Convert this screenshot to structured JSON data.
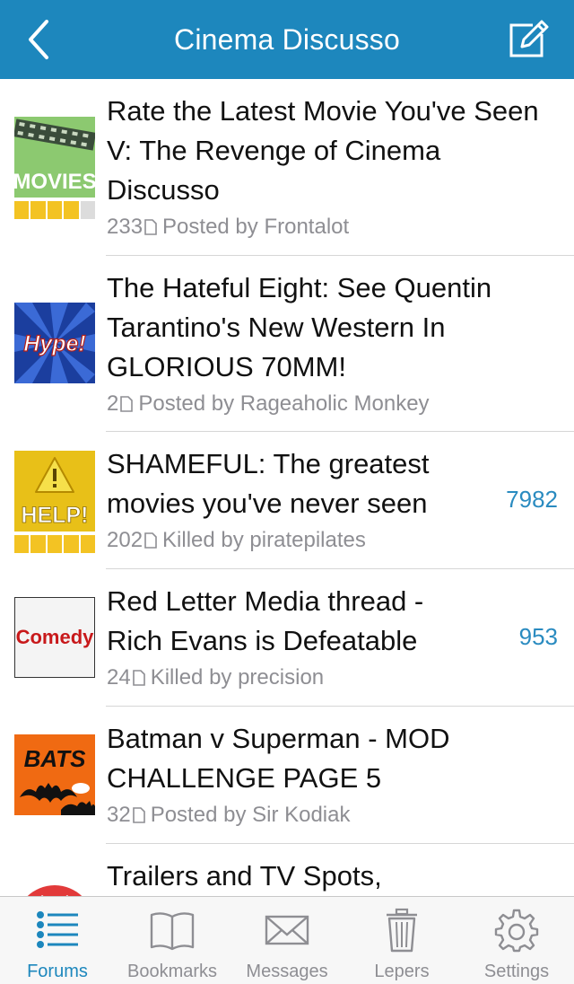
{
  "header": {
    "title": "Cinema Discusso"
  },
  "threads": [
    {
      "icon_label": "MOVIES",
      "title": "Rate the Latest Movie You've Seen V: The Revenge of Cinema Discusso",
      "pages": "233",
      "byline": "Posted by Frontalot",
      "unread": "",
      "rating": 4
    },
    {
      "icon_label": "Hype!",
      "title": "The Hateful Eight: See Quentin Tarantino's New Western In GLORIOUS 70MM!",
      "pages": "2",
      "byline": "Posted by Rageaholic Monkey",
      "unread": ""
    },
    {
      "icon_label": "HELP!",
      "title": "SHAMEFUL: The greatest movies you've never seen",
      "pages": "202",
      "byline": "Killed by piratepilates",
      "unread": "7982",
      "rating": 5
    },
    {
      "icon_label": "Comedy",
      "title": "Red Letter Media thread - Rich Evans is Defeatable",
      "pages": "24",
      "byline": "Killed by precision",
      "unread": "953"
    },
    {
      "icon_label": "BATS",
      "title": "Batman v Superman - MOD CHALLENGE PAGE 5",
      "pages": "32",
      "byline": "Posted by Sir Kodiak",
      "unread": ""
    },
    {
      "icon_label": "",
      "title": "Trailers and TV Spots,",
      "pages": "",
      "byline": "",
      "unread": ""
    }
  ],
  "tabs": [
    {
      "label": "Forums",
      "icon": "list-icon",
      "active": true
    },
    {
      "label": "Bookmarks",
      "icon": "book-icon"
    },
    {
      "label": "Messages",
      "icon": "envelope-icon"
    },
    {
      "label": "Lepers",
      "icon": "trash-icon"
    },
    {
      "label": "Settings",
      "icon": "gear-icon"
    }
  ],
  "colors": {
    "accent": "#1d87bd",
    "unread": "#2a8bc0",
    "rating": "#f3c323"
  }
}
